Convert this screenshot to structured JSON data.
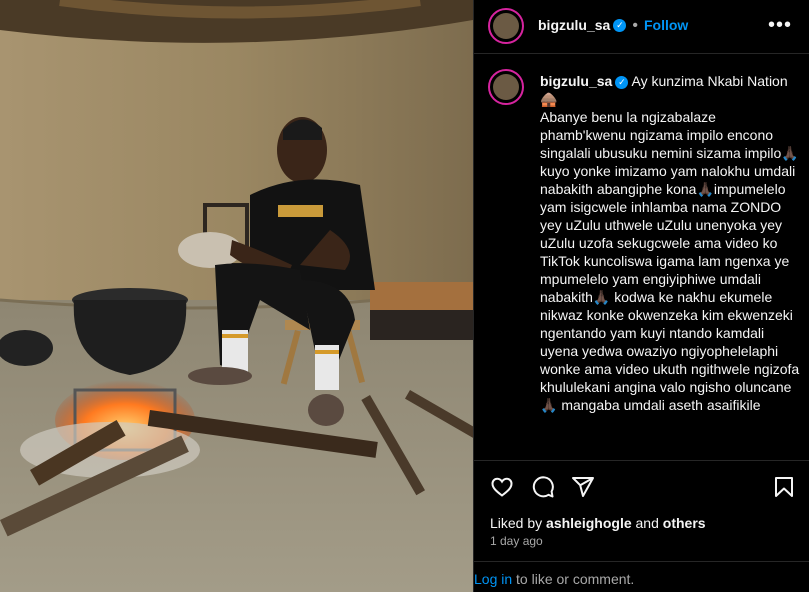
{
  "post": {
    "image_alt": "Man sitting on a stool beside a pot over a fire inside a hut"
  },
  "header": {
    "username": "bigzulu_sa",
    "separator": "•",
    "follow_label": "Follow",
    "more_label": "•••",
    "verified_mark": "✓"
  },
  "caption": {
    "username": "bigzulu_sa",
    "text": "Ay kunzima Nkabi Nation🛖\nAbanye benu la ngizabalaze phamb'kwenu ngizama impilo encono singalali ubusuku nemini sizama impilo🙏🏿kuyo yonke imizamo yam nalokhu umdali nabakith abangiphe kona🙏🏿impumelelo yam isigcwele inhlamba nama ZONDO yey uZulu uthwele uZulu unenyoka yey uZulu uzofa sekugcwele ama video ko TikTok kuncoliswa igama lam ngenxa ye mpumelelo yam engiyiphiwe umdali nabakith🙏🏿 kodwa ke nakhu ekumele nikwaz konke okwenzeka kim ekwenzeki ngentando yam kuyi ntando kamdali uyena yedwa owaziyo ngiyophelelaphi wonke ama video ukuth ngithwele ngizofa khululekani angina valo ngisho oluncane🙏🏿 mangaba umdali aseth asaifikile"
  },
  "actions": {
    "like": "like-icon",
    "comment": "comment-icon",
    "share": "share-icon",
    "save": "save-icon"
  },
  "likes": {
    "prefix": "Liked by",
    "user": "ashleighogle",
    "middle": "and",
    "others": "others"
  },
  "date": "1 day ago",
  "login": {
    "link": "Log in",
    "rest": " to like or comment."
  },
  "colors": {
    "accent": "#0095f6",
    "background": "#000000",
    "text": "#f5f5f5",
    "muted": "#a8a8a8"
  }
}
